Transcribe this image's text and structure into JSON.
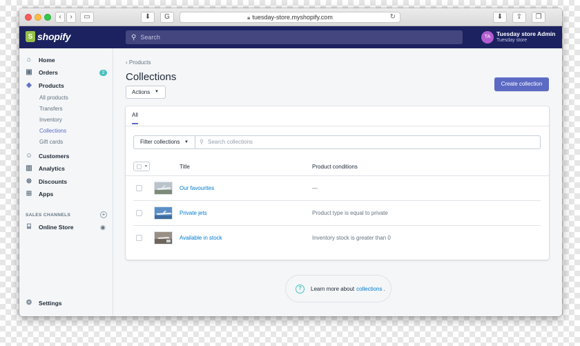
{
  "browser": {
    "url": "tuesday-store.myshopify.com"
  },
  "topbar": {
    "logo_text": "shopify",
    "search_placeholder": "Search",
    "avatar_initials": "TA",
    "store_name": "Tuesday store Admin",
    "store_sub": "Tuesday store"
  },
  "sidebar": {
    "items": [
      {
        "label": "Home",
        "icon": "home-icon"
      },
      {
        "label": "Orders",
        "icon": "orders-icon",
        "badge": "2"
      },
      {
        "label": "Products",
        "icon": "tag-icon"
      }
    ],
    "product_subitems": [
      "All products",
      "Transfers",
      "Inventory",
      "Collections",
      "Gift cards"
    ],
    "active_subitem": "Collections",
    "items2": [
      {
        "label": "Customers",
        "icon": "person-icon"
      },
      {
        "label": "Analytics",
        "icon": "chart-icon"
      },
      {
        "label": "Discounts",
        "icon": "discount-icon"
      },
      {
        "label": "Apps",
        "icon": "apps-icon"
      }
    ],
    "sales_channels_title": "SALES CHANNELS",
    "online_store": "Online Store",
    "settings": "Settings"
  },
  "main": {
    "breadcrumb": "Products",
    "title": "Collections",
    "actions_label": "Actions",
    "create_label": "Create collection",
    "tab_all": "All",
    "filter_label": "Filter collections",
    "search_placeholder": "Search collections",
    "columns": [
      "Title",
      "Product conditions"
    ],
    "rows": [
      {
        "title": "Our favourites",
        "condition": "—"
      },
      {
        "title": "Private jets",
        "condition": "Product type is equal to private"
      },
      {
        "title": "Available in stock",
        "condition": "Inventory stock is greater than 0"
      }
    ],
    "learn_prefix": "Learn more about",
    "learn_link": "collections",
    "learn_suffix": "."
  },
  "colors": {
    "topbar": "#1c2260",
    "accent": "#5c6ac4",
    "link": "#007ace",
    "badge": "#47c1bf"
  }
}
